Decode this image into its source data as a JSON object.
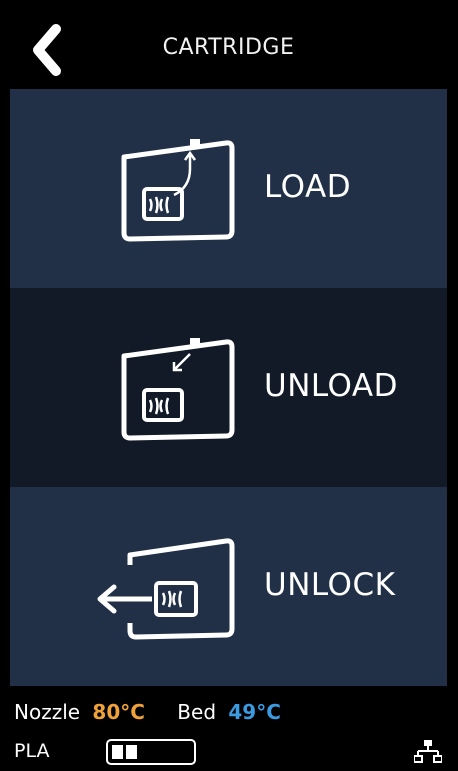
{
  "header": {
    "title": "CARTRIDGE",
    "back_icon": "chevron-left-icon"
  },
  "tiles": [
    {
      "label": "LOAD",
      "icon": "cartridge-load-icon",
      "background": "#213046"
    },
    {
      "label": "UNLOAD",
      "icon": "cartridge-unload-icon",
      "background": "#111a26"
    },
    {
      "label": "UNLOCK",
      "icon": "cartridge-unlock-icon",
      "background": "#213046"
    }
  ],
  "status": {
    "nozzle_label": "Nozzle",
    "nozzle_value": "80°C",
    "bed_label": "Bed",
    "bed_value": "49°C",
    "material": "PLA",
    "material_level_fraction": 0.3,
    "network_icon": "network-icon"
  },
  "colors": {
    "nozzle": "#f0a23a",
    "bed": "#3b9ae0"
  }
}
